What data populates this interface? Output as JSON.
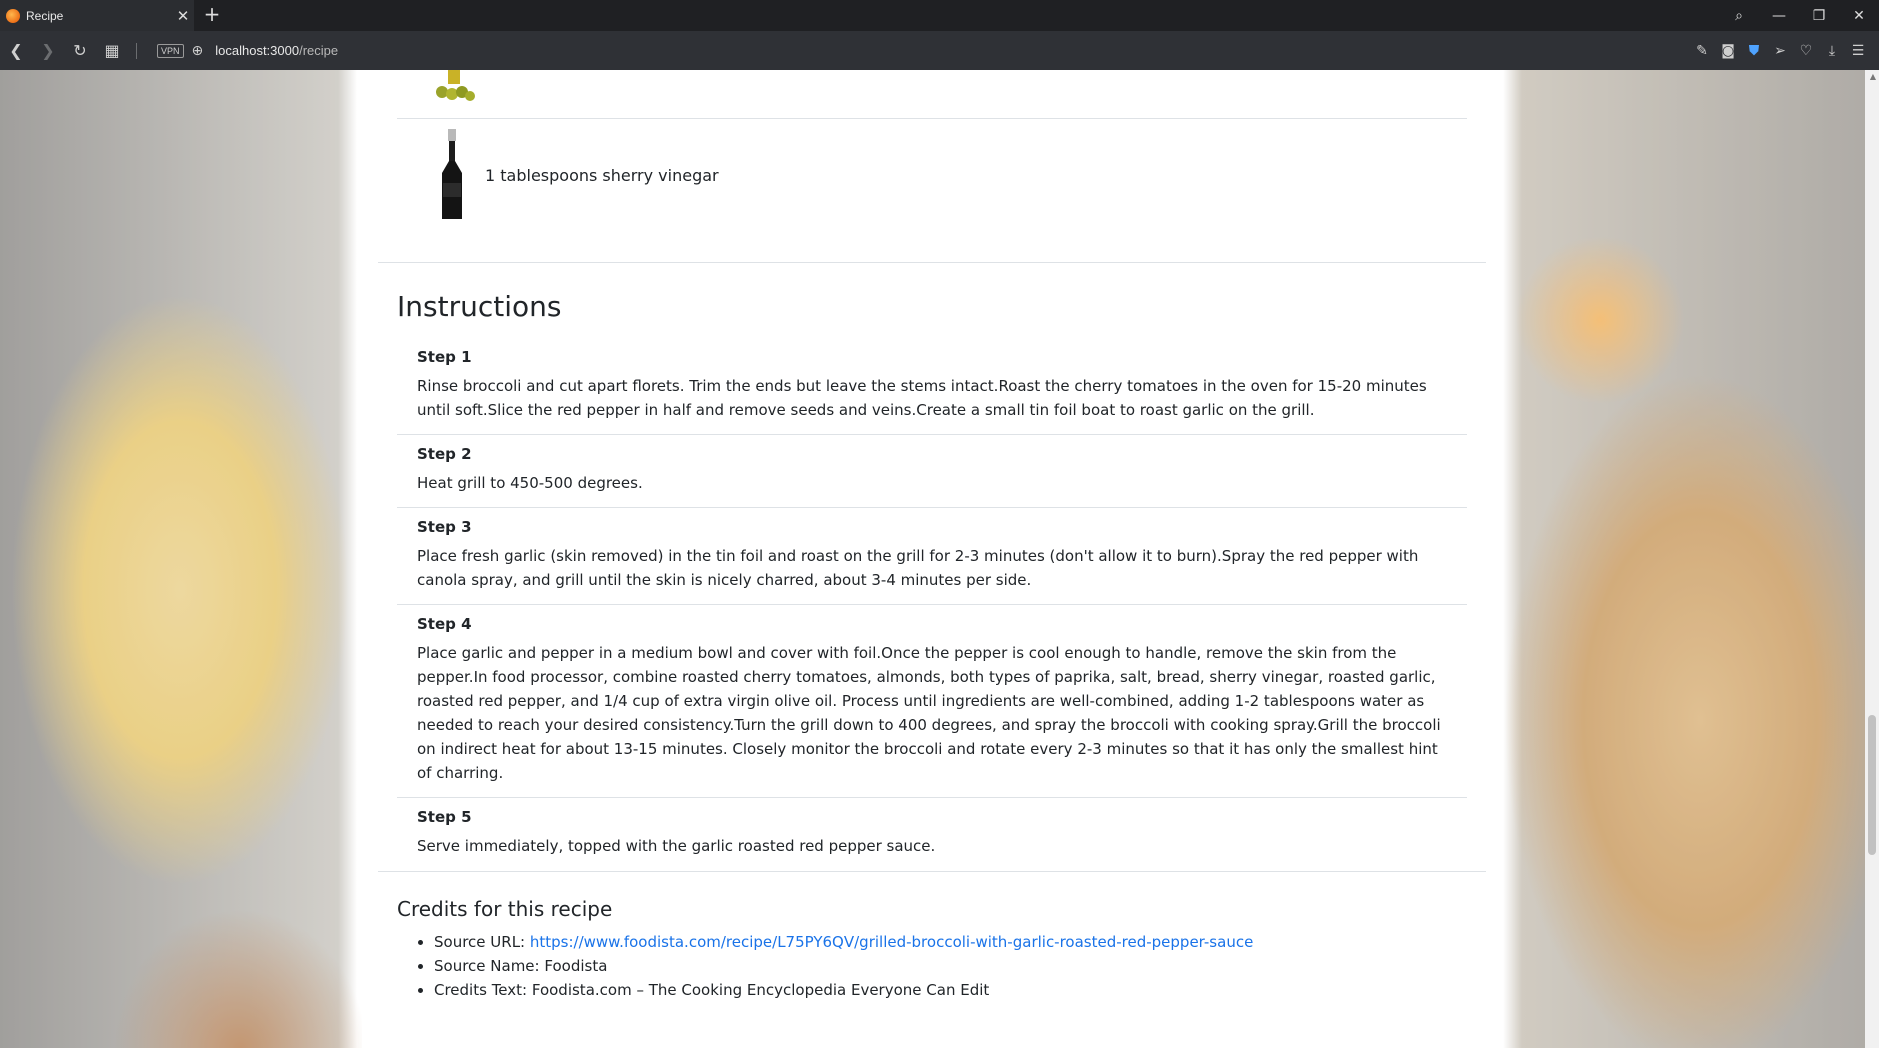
{
  "browser": {
    "tab_title": "Recipe",
    "tab_close": "✕",
    "new_tab": "+",
    "url_host": "localhost:3000",
    "url_path": "/recipe",
    "vpn_label": "VPN"
  },
  "ingredient": {
    "text": "1 tablespoons sherry vinegar"
  },
  "instructions": {
    "title": "Instructions",
    "steps": [
      {
        "label": "Step 1",
        "text": "Rinse broccoli and cut apart florets. Trim the ends but leave the stems intact.Roast the cherry tomatoes in the oven for 15-20 minutes until soft.Slice the red pepper in half and remove seeds and veins.Create a small tin foil boat to roast garlic on the grill."
      },
      {
        "label": "Step 2",
        "text": "Heat grill to 450-500 degrees."
      },
      {
        "label": "Step 3",
        "text": "Place fresh garlic (skin removed) in the tin foil and roast on the grill for 2-3 minutes (don't allow it to burn).Spray the red pepper with canola spray, and grill until the skin is nicely charred, about 3-4 minutes per side."
      },
      {
        "label": "Step 4",
        "text": "Place garlic and pepper in a medium bowl and cover with foil.Once the pepper is cool enough to handle, remove the skin from the pepper.In food processor, combine roasted cherry tomatoes, almonds, both types of paprika, salt, bread, sherry vinegar, roasted garlic, roasted red pepper, and 1/4 cup of extra virgin olive oil. Process until ingredients are well-combined, adding 1-2 tablespoons water as needed to reach your desired consistency.Turn the grill down to 400 degrees, and spray the broccoli with cooking spray.Grill the broccoli on indirect heat for about 13-15 minutes. Closely monitor the broccoli and rotate every 2-3 minutes so that it has only the smallest hint of charring."
      },
      {
        "label": "Step 5",
        "text": "Serve immediately, topped with the garlic roasted red pepper sauce."
      }
    ]
  },
  "credits": {
    "title": "Credits for this recipe",
    "source_url_label": "Source URL: ",
    "source_url": "https://www.foodista.com/recipe/L75PY6QV/grilled-broccoli-with-garlic-roasted-red-pepper-sauce",
    "source_name_label": "Source Name: ",
    "source_name": "Foodista",
    "credits_text_label": "Credits Text: ",
    "credits_text": "Foodista.com – The Cooking Encyclopedia Everyone Can Edit"
  },
  "colors": {
    "link": "#1a73e8",
    "divider": "#dee2e6"
  }
}
